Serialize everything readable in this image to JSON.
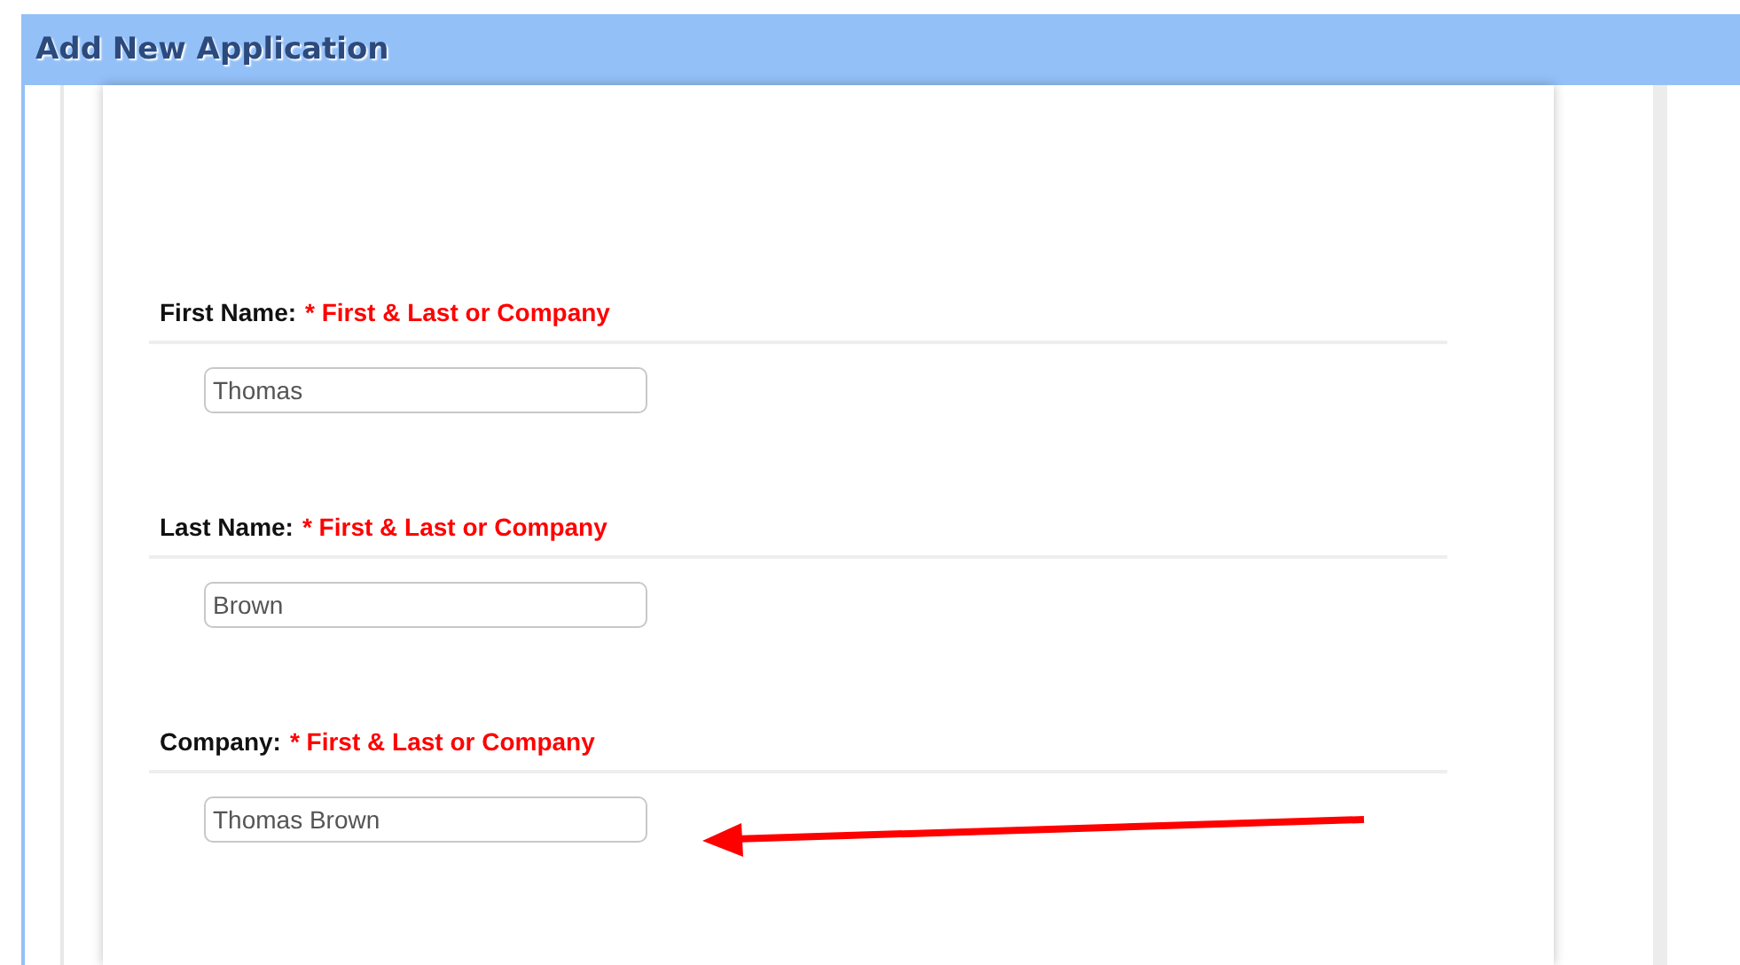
{
  "window": {
    "title": "Add New Application"
  },
  "fields": [
    {
      "label": "First Name:",
      "required_note": "* First & Last or Company",
      "value": "Thomas"
    },
    {
      "label": "Last Name:",
      "required_note": "* First & Last or Company",
      "value": "Brown"
    },
    {
      "label": "Company:",
      "required_note": "* First & Last or Company",
      "value": "Thomas Brown"
    }
  ]
}
